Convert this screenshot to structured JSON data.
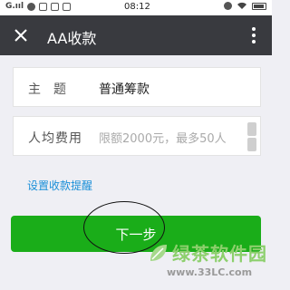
{
  "status_bar": {
    "carrier": "G.ııl",
    "time": "08:12"
  },
  "header": {
    "title": "AA收款"
  },
  "form": {
    "subject": {
      "label": "主题",
      "value": "普通筹款"
    },
    "per_person": {
      "label": "人均费用",
      "placeholder": "限额2000元，最多50人"
    }
  },
  "reminder_link": "设置收款提醒",
  "next_button": "下一步",
  "watermark": {
    "name": "绿茶软件园",
    "url": "www.33LC.com"
  },
  "colors": {
    "header_bg": "#393a3f",
    "button_green": "#1aad19",
    "link_blue": "#1a8fd8",
    "page_bg": "#efeff4"
  }
}
